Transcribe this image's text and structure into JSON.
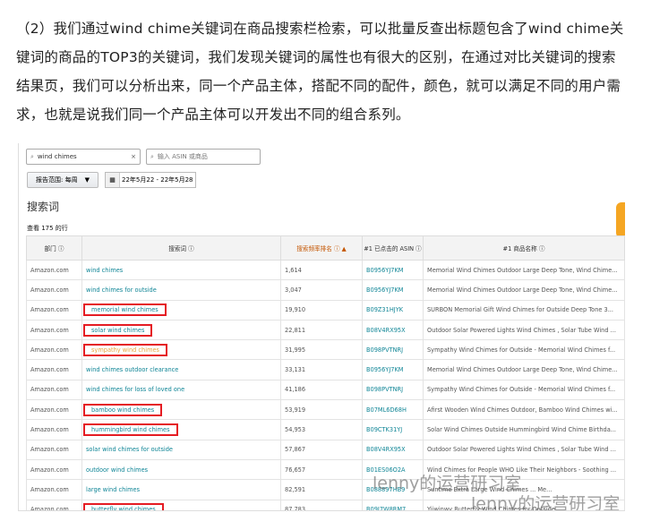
{
  "paragraph": "（2）我们通过wind chime关键词在商品搜索栏检索，可以批量反查出标题包含了wind chime关键词的商品的TOP3的关键词，我们发现关键词的属性也有很大的区别，在通过对比关键词的搜索结果页，我们可以分析出来，同一个产品主体，搭配不同的配件，颜色，就可以满足不同的用户需求，也就是说我们同一个产品主体可以开发出不同的组合系列。",
  "search": {
    "value": "wind chimes",
    "clear": "×",
    "asin_placeholder": "输入 ASIN 或商品"
  },
  "report_range": "报告范围: 每周",
  "date_range": "22年5月22 - 22年5月28",
  "section_title": "搜索词",
  "row_count": "查看 175 的行",
  "columns": [
    "部门 ⓘ",
    "搜索词 ⓘ",
    "搜索频率排名 ⓘ ▲",
    "#1 已点击的 ASIN ⓘ",
    "#1 商品名称 ⓘ"
  ],
  "rows": [
    {
      "dept": "Amazon.com",
      "kw": "wind chimes",
      "rank": "1,614",
      "asin": "B0956YJ7KM",
      "name": "Memorial Wind Chimes Outdoor Large Deep Tone, Wind Chime..."
    },
    {
      "dept": "Amazon.com",
      "kw": "wind chimes for outside",
      "rank": "3,047",
      "asin": "B0956YJ7KM",
      "name": "Memorial Wind Chimes Outdoor Large Deep Tone, Wind Chime..."
    },
    {
      "dept": "Amazon.com",
      "kw": "memorial wind chimes",
      "rank": "19,910",
      "asin": "B09Z31HJYK",
      "name": "SURBON Memorial Gift Wind Chimes for Outside Deep Tone 3...",
      "boxed": true
    },
    {
      "dept": "Amazon.com",
      "kw": "solar wind chimes",
      "rank": "22,811",
      "asin": "B08V4RX95X",
      "name": "Outdoor Solar Powered Lights Wind Chimes , Solar Tube Wind ...",
      "boxed": true
    },
    {
      "dept": "Amazon.com",
      "kw": "sympathy wind chimes",
      "rank": "31,995",
      "asin": "B098PVTNRJ",
      "name": "Sympathy Wind Chimes for Outside - Memorial Wind Chimes f...",
      "boxed": true,
      "hover": true
    },
    {
      "dept": "Amazon.com",
      "kw": "wind chimes outdoor clearance",
      "rank": "33,131",
      "asin": "B0956YJ7KM",
      "name": "Memorial Wind Chimes Outdoor Large Deep Tone, Wind Chime..."
    },
    {
      "dept": "Amazon.com",
      "kw": "wind chimes for loss of loved one",
      "rank": "41,186",
      "asin": "B098PVTNRJ",
      "name": "Sympathy Wind Chimes for Outside - Memorial Wind Chimes f..."
    },
    {
      "dept": "Amazon.com",
      "kw": "bamboo wind chimes",
      "rank": "53,919",
      "asin": "B07ML6D68H",
      "name": "Afirst Wooden Wind Chimes Outdoor, Bamboo Wind Chimes wi...",
      "boxed": true
    },
    {
      "dept": "Amazon.com",
      "kw": "hummingbird wind chimes",
      "rank": "54,953",
      "asin": "B09CTK31YJ",
      "name": "Solar Wind Chimes Outside Hummingbird Wind Chime Birthda...",
      "boxed": true
    },
    {
      "dept": "Amazon.com",
      "kw": "solar wind chimes for outside",
      "rank": "57,867",
      "asin": "B08V4RX95X",
      "name": "Outdoor Solar Powered Lights Wind Chimes , Solar Tube Wind ..."
    },
    {
      "dept": "Amazon.com",
      "kw": "outdoor wind chimes",
      "rank": "76,657",
      "asin": "B01ES06O2A",
      "name": "Wind Chimes for People WHO Like Their Neighbors - Soothing ..."
    },
    {
      "dept": "Amazon.com",
      "kw": "large wind chimes",
      "rank": "82,591",
      "asin": "B088897HB9",
      "name": "Suntime Extra Large Wind Chimes ... Me..."
    },
    {
      "dept": "Amazon.com",
      "kw": "butterfly wind chimes",
      "rank": "87,783",
      "asin": "B09J7W8RM7",
      "name": "Yiiwinwy Butterfly Wind Chimes for Outside ...",
      "boxed": true
    }
  ],
  "watermark": "lenny的运营研习室"
}
